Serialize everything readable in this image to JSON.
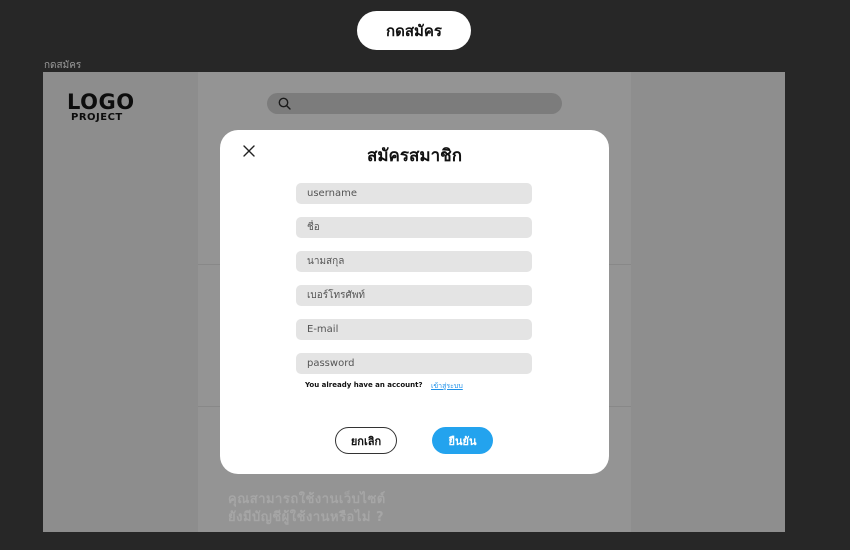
{
  "top_button": {
    "label": "กดสมัคร"
  },
  "frame": {
    "label": "กดสมัคร",
    "logo": {
      "line1": "LOGO",
      "line2": "PROJECT"
    },
    "search": {
      "icon": "search-icon"
    },
    "faded_lines": [
      "คุณสามารถใช้งานเว็บไซต์",
      "ยังมีบัญชีผู้ใช้งานหรือไม่ ?"
    ]
  },
  "modal": {
    "title": "สมัครสมาชิก",
    "close_icon": "close-icon",
    "fields": {
      "username": "username",
      "first_name": "ชื่อ",
      "last_name": "นามสกุล",
      "phone": "เบอร์โทรศัพท์",
      "email": "E-mail",
      "password": "password"
    },
    "account_prompt": "You already have an account?",
    "login_link": "เข้าสู่ระบบ",
    "cancel_label": "ยกเลิก",
    "confirm_label": "ยืนยัน"
  },
  "colors": {
    "background": "#272727",
    "overlay": "#8f8f8f",
    "accent": "#23a3ee",
    "field": "#e4e4e4"
  }
}
